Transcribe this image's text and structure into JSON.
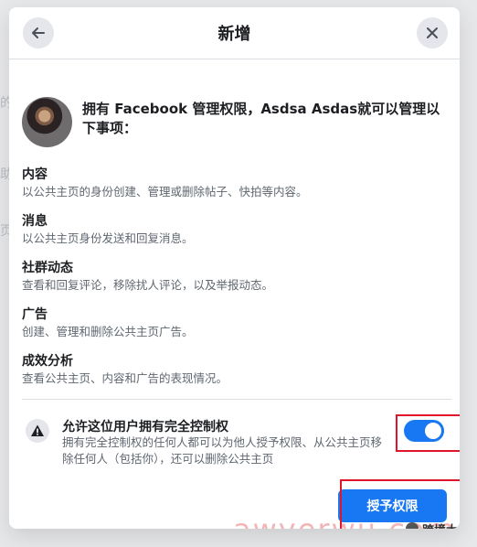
{
  "background": {
    "partial_text_1": "的",
    "partial_text_2": "助",
    "partial_text_3": "",
    "partial_text_4": "页"
  },
  "dialog": {
    "title": "新增",
    "intro": "拥有 Facebook 管理权限，Asdsa Asdas就可以管理以下事项：",
    "permissions": [
      {
        "title": "内容",
        "description": "以公共主页的身份创建、管理或删除帖子、快拍等内容。"
      },
      {
        "title": "消息",
        "description": "以公共主页身份发送和回复消息。"
      },
      {
        "title": "社群动态",
        "description": "查看和回复评论，移除扰人评论，以及举报动态。"
      },
      {
        "title": "广告",
        "description": "创建、管理和删除公共主页广告。"
      },
      {
        "title": "成效分析",
        "description": "查看公共主页、内容和广告的表现情况。"
      }
    ],
    "full_control": {
      "title": "允许这位用户拥有完全控制权",
      "description": "拥有完全控制权的任何人都可以为他人授予权限、从公共主页移除任何人（包括你），还可以删除公共主页",
      "enabled": true
    },
    "grant_button": "授予权限"
  },
  "watermark": {
    "text": "awyerwu.com",
    "label": "跨境大王"
  },
  "colors": {
    "accent": "#1877f2",
    "highlight": "#e0142a"
  }
}
